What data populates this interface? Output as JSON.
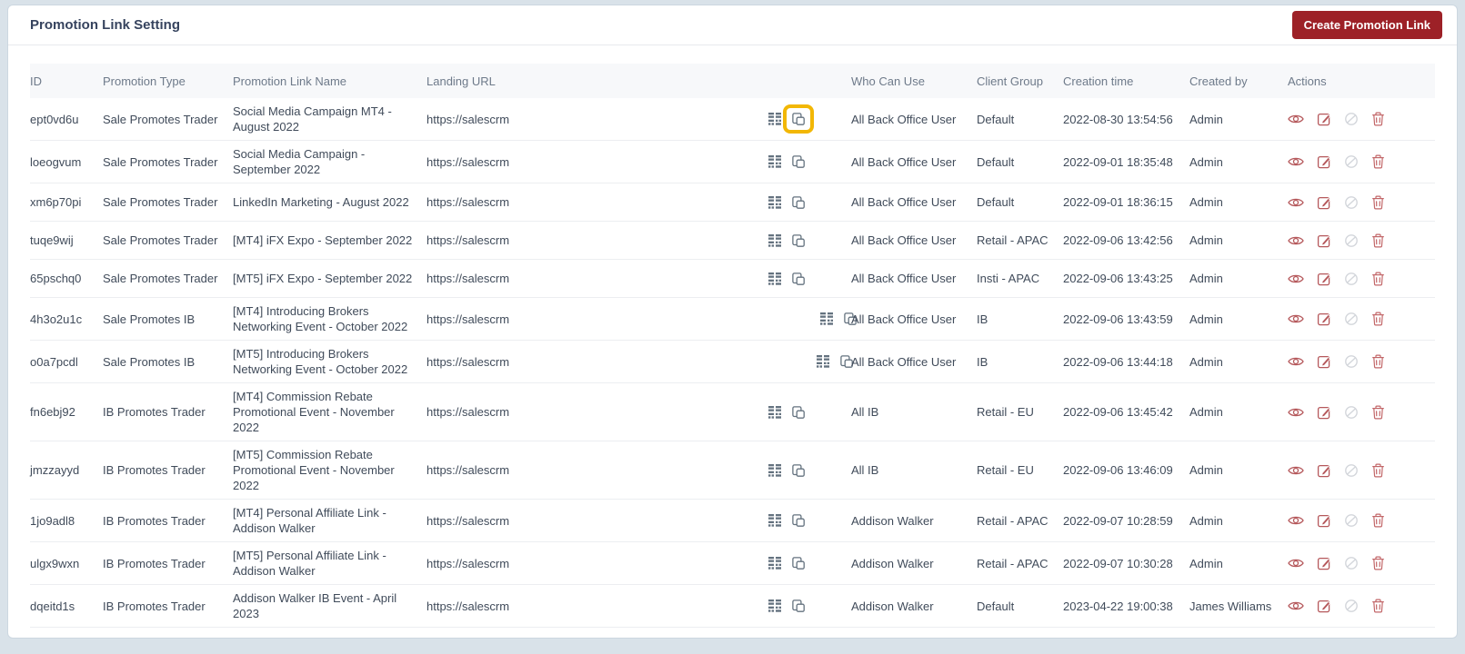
{
  "page": {
    "title": "Promotion Link Setting",
    "create_button_label": "Create Promotion Link"
  },
  "colors": {
    "page_background": "#d9e2e9",
    "create_button_bg": "#9d2127",
    "highlight_box": "#f2b705",
    "action_icon_red": "#b5585b",
    "action_icon_disabled": "#d3d6db",
    "link_icon_gray": "#64727f"
  },
  "table": {
    "columns": [
      "ID",
      "Promotion Type",
      "Promotion Link Name",
      "Landing URL",
      "Who Can Use",
      "Client Group",
      "Creation time",
      "Created by",
      "Actions"
    ],
    "link_icon_names": [
      "qr-code-icon",
      "copy-icon"
    ],
    "action_icon_names": [
      "eye-icon",
      "edit-icon",
      "ban-icon",
      "trash-icon"
    ],
    "rows": [
      {
        "id": "ept0vd6u",
        "promotion_type": "Sale Promotes Trader",
        "link_name": "Social Media Campaign MT4 - August 2022",
        "landing_url": "https://salescrm",
        "who_can_use": "All Back Office User",
        "client_group": "Default",
        "creation_time": "2022-08-30 13:54:56",
        "created_by": "Admin",
        "copy_highlighted": true
      },
      {
        "id": "loeogvum",
        "promotion_type": "Sale Promotes Trader",
        "link_name": "Social Media Campaign - September 2022",
        "landing_url": "https://salescrm",
        "who_can_use": "All Back Office User",
        "client_group": "Default",
        "creation_time": "2022-09-01 18:35:48",
        "created_by": "Admin",
        "copy_highlighted": false
      },
      {
        "id": "xm6p70pi",
        "promotion_type": "Sale Promotes Trader",
        "link_name": "LinkedIn Marketing - August 2022",
        "landing_url": "https://salescrm",
        "who_can_use": "All Back Office User",
        "client_group": "Default",
        "creation_time": "2022-09-01 18:36:15",
        "created_by": "Admin",
        "copy_highlighted": false
      },
      {
        "id": "tuqe9wij",
        "promotion_type": "Sale Promotes Trader",
        "link_name": "[MT4] iFX Expo - September 2022",
        "landing_url": "https://salescrm",
        "who_can_use": "All Back Office User",
        "client_group": "Retail - APAC",
        "creation_time": "2022-09-06 13:42:56",
        "created_by": "Admin",
        "copy_highlighted": false
      },
      {
        "id": "65pschq0",
        "promotion_type": "Sale Promotes Trader",
        "link_name": "[MT5] iFX Expo - September 2022",
        "landing_url": "https://salescrm",
        "who_can_use": "All Back Office User",
        "client_group": "Insti - APAC",
        "creation_time": "2022-09-06 13:43:25",
        "created_by": "Admin",
        "copy_highlighted": false
      },
      {
        "id": "4h3o2u1c",
        "promotion_type": "Sale Promotes IB",
        "link_name": "[MT4] Introducing Brokers Networking Event - October 2022",
        "landing_url": "https://salescrm",
        "who_can_use": "All Back Office User",
        "client_group": "IB",
        "creation_time": "2022-09-06 13:43:59",
        "created_by": "Admin",
        "copy_highlighted": false
      },
      {
        "id": "o0a7pcdl",
        "promotion_type": "Sale Promotes IB",
        "link_name": "[MT5] Introducing Brokers Networking Event - October 2022",
        "landing_url": "https://salescrm",
        "who_can_use": "All Back Office User",
        "client_group": "IB",
        "creation_time": "2022-09-06 13:44:18",
        "created_by": "Admin",
        "copy_highlighted": false
      },
      {
        "id": "fn6ebj92",
        "promotion_type": "IB Promotes Trader",
        "link_name": "[MT4] Commission Rebate Promotional Event - November 2022",
        "landing_url": "https://salescrm",
        "who_can_use": "All IB",
        "client_group": "Retail - EU",
        "creation_time": "2022-09-06 13:45:42",
        "created_by": "Admin",
        "copy_highlighted": false
      },
      {
        "id": "jmzzayyd",
        "promotion_type": "IB Promotes Trader",
        "link_name": "[MT5] Commission Rebate Promotional Event - November 2022",
        "landing_url": "https://salescrm",
        "who_can_use": "All IB",
        "client_group": "Retail - EU",
        "creation_time": "2022-09-06 13:46:09",
        "created_by": "Admin",
        "copy_highlighted": false
      },
      {
        "id": "1jo9adl8",
        "promotion_type": "IB Promotes Trader",
        "link_name": "[MT4] Personal Affiliate Link - Addison Walker",
        "landing_url": "https://salescrm",
        "who_can_use": "Addison Walker",
        "client_group": "Retail - APAC",
        "creation_time": "2022-09-07 10:28:59",
        "created_by": "Admin",
        "copy_highlighted": false
      },
      {
        "id": "ulgx9wxn",
        "promotion_type": "IB Promotes Trader",
        "link_name": "[MT5] Personal Affiliate Link - Addison Walker",
        "landing_url": "https://salescrm",
        "who_can_use": "Addison Walker",
        "client_group": "Retail - APAC",
        "creation_time": "2022-09-07 10:30:28",
        "created_by": "Admin",
        "copy_highlighted": false
      },
      {
        "id": "dqeitd1s",
        "promotion_type": "IB Promotes Trader",
        "link_name": "Addison Walker IB Event - April 2023",
        "landing_url": "https://salescrm",
        "who_can_use": "Addison Walker",
        "client_group": "Default",
        "creation_time": "2023-04-22 19:00:38",
        "created_by": "James Williams",
        "copy_highlighted": false
      }
    ]
  }
}
